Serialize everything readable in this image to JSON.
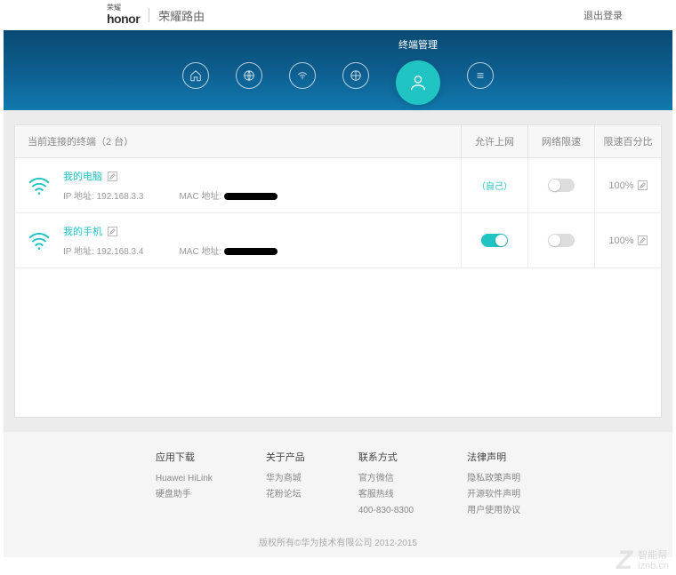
{
  "header": {
    "brand_small": "荣耀",
    "brand": "honor",
    "title": "荣耀路由",
    "logout": "退出登录"
  },
  "nav": {
    "active_label": "终端管理"
  },
  "table": {
    "header_device": "当前连接的终端（2 台）",
    "header_allow": "允许上网",
    "header_limit": "网络限速",
    "header_percent": "限速百分比",
    "self_text": "（自己）",
    "rows": [
      {
        "name": "我的电脑",
        "ip_label": "IP 地址:",
        "ip": "192.168.3.3",
        "mac_label": "MAC 地址:",
        "is_self": true,
        "allow_on": false,
        "limit_on": false,
        "percent": "100%"
      },
      {
        "name": "我的手机",
        "ip_label": "IP 地址:",
        "ip": "192.168.3.4",
        "mac_label": "MAC 地址:",
        "is_self": false,
        "allow_on": true,
        "limit_on": false,
        "percent": "100%"
      }
    ]
  },
  "footer": {
    "cols": [
      {
        "title": "应用下载",
        "links": [
          "Huawei HiLink",
          "硬盘助手"
        ]
      },
      {
        "title": "关于产品",
        "links": [
          "华为商城",
          "花粉论坛"
        ]
      },
      {
        "title": "联系方式",
        "links": [
          "官方微信",
          "客服热线",
          "400-830-8300"
        ]
      },
      {
        "title": "法律声明",
        "links": [
          "隐私政策声明",
          "开源软件声明",
          "用户使用协议"
        ]
      }
    ],
    "copyright": "版权所有©华为技术有限公司 2012-2015"
  },
  "watermark": {
    "brand": "Z",
    "line1": "智能帮",
    "line2": "iznb.cn"
  }
}
